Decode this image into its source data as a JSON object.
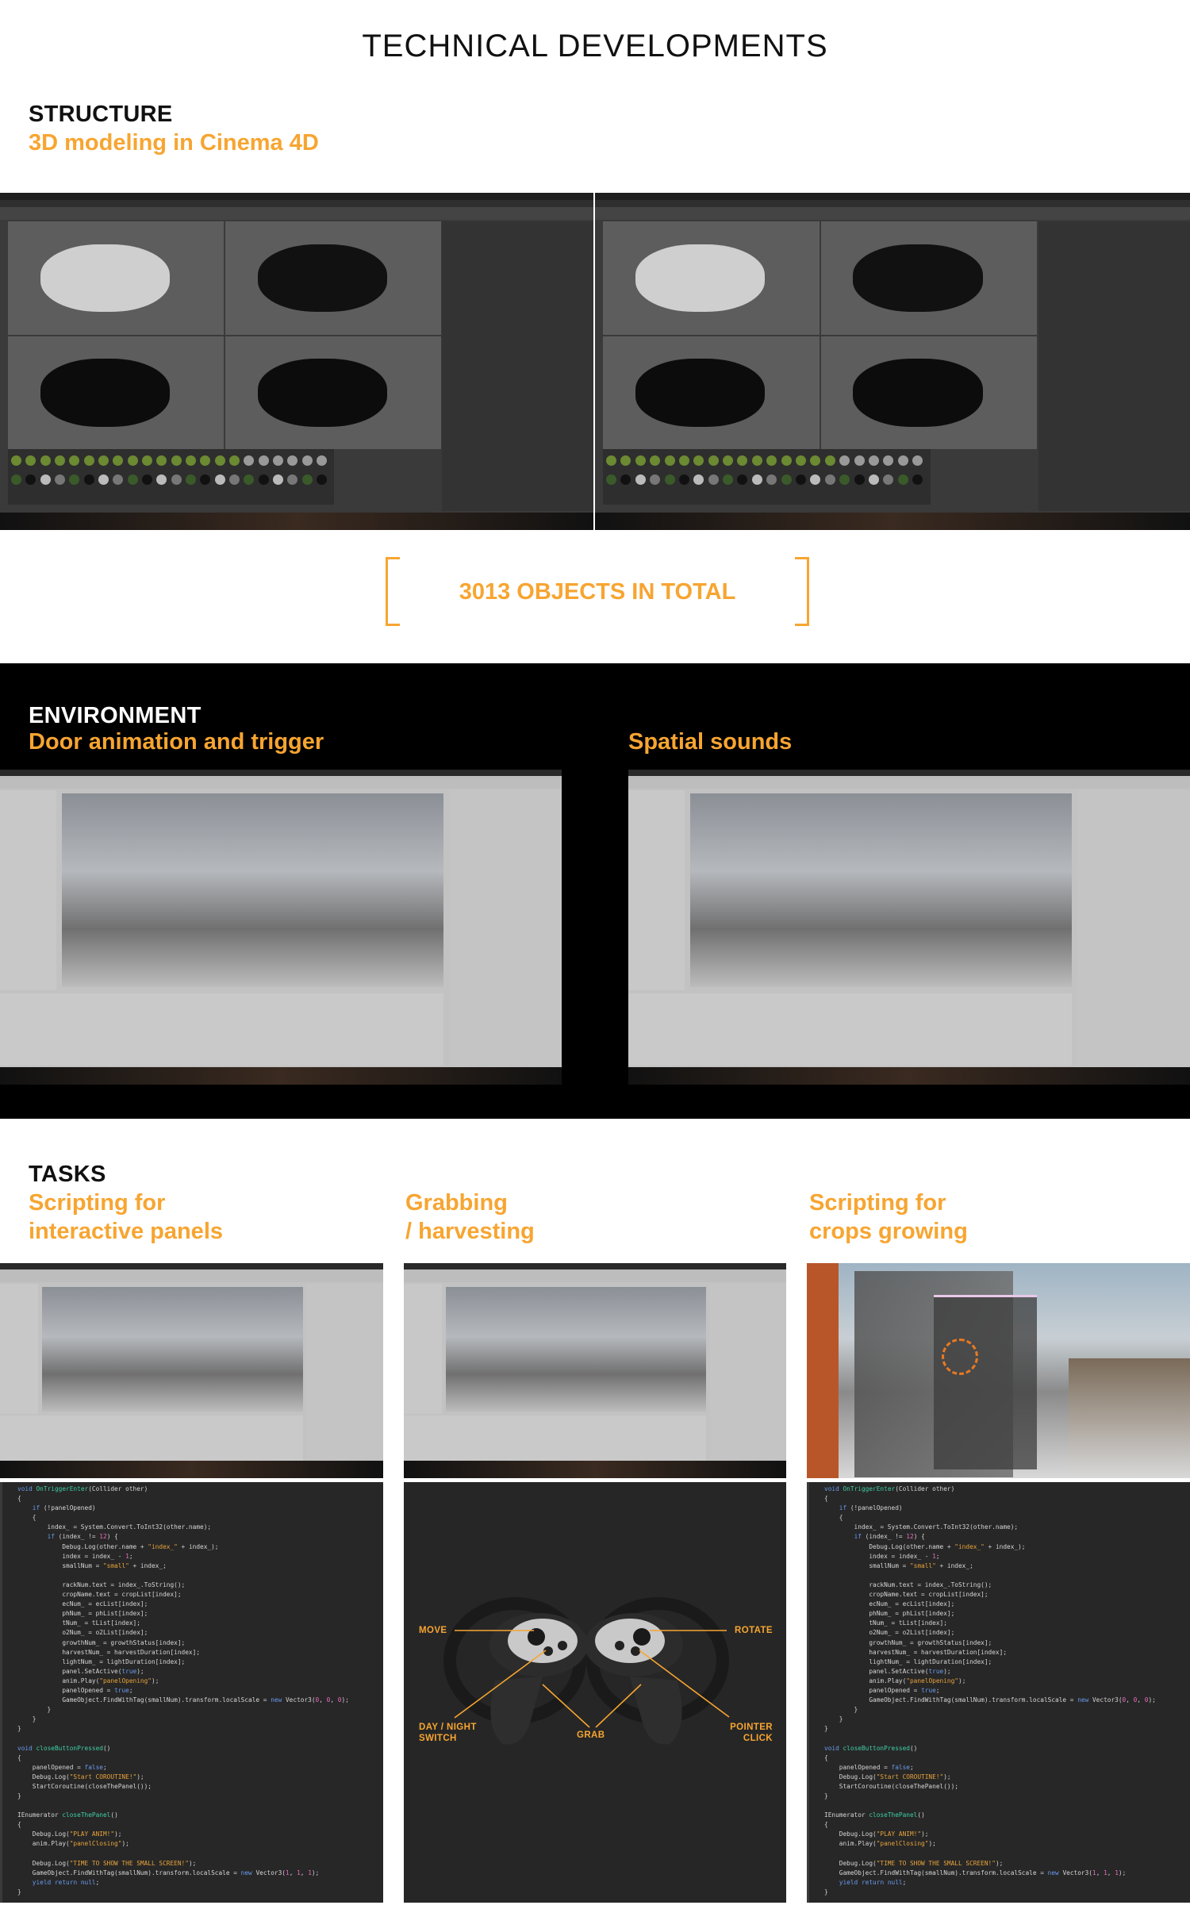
{
  "page_title": "TECHNICAL DEVELOPMENTS",
  "structure": {
    "heading": "STRUCTURE",
    "subtitle": "3D modeling in Cinema 4D",
    "callout": "3013 OBJECTS IN TOTAL"
  },
  "environment": {
    "heading": "ENVIRONMENT",
    "left_subtitle": "Door animation and trigger",
    "right_subtitle": "Spatial sounds"
  },
  "tasks": {
    "heading": "TASKS",
    "columns": [
      {
        "line1": "Scripting for",
        "line2": "interactive panels"
      },
      {
        "line1": "Grabbing",
        "line2": "/ harvesting"
      },
      {
        "line1": "Scripting for",
        "line2": "crops growing"
      }
    ]
  },
  "controller": {
    "move": "MOVE",
    "rotate": "ROTATE",
    "day_night_1": "DAY / NIGHT",
    "day_night_2": "SWITCH",
    "grab": "GRAB",
    "pointer_1": "POINTER",
    "pointer_2": "CLICK"
  },
  "colors": {
    "accent": "#f7a531",
    "code_bg": "#272727"
  },
  "code_lines": [
    "void OnTriggerEnter(Collider other)",
    "{",
    "    if (!panelOpened)",
    "    {",
    "        index_ = System.Convert.ToInt32(other.name);",
    "        if (index_ != 12) {",
    "            Debug.Log(other.name + \"index_\" + index_);",
    "            index = index_ - 1;",
    "            smallNum = \"small\" + index_;",
    "",
    "            rackNum.text = index_.ToString();",
    "            cropName.text = cropList[index];",
    "            ecNum_ = ecList[index];",
    "            phNum_ = phList[index];",
    "            tNum_ = tList[index];",
    "            o2Num_ = o2List[index];",
    "            growthNum_ = growthStatus[index];",
    "            harvestNum_ = harvestDuration[index];",
    "            lightNum_ = lightDuration[index];",
    "            panel.SetActive(true);",
    "            anim.Play(\"panelOpening\");",
    "            panelOpened = true;",
    "            GameObject.FindWithTag(smallNum).transform.localScale = new Vector3(0, 0, 0);",
    "        }",
    "    }",
    "}",
    "",
    "void closeButtonPressed()",
    "{",
    "    panelOpened = false;",
    "    Debug.Log(\"Start COROUTINE!\");",
    "    StartCoroutine(closeThePanel());",
    "}",
    "",
    "IEnumerator closeThePanel()",
    "{",
    "    Debug.Log(\"PLAY ANIM!\");",
    "    anim.Play(\"panelClosing\");",
    "",
    "    Debug.Log(\"TIME TO SHOW THE SMALL SCREEN!\");",
    "    GameObject.FindWithTag(smallNum).transform.localScale = new Vector3(1, 1, 1);",
    "    yield return null;",
    "}"
  ]
}
